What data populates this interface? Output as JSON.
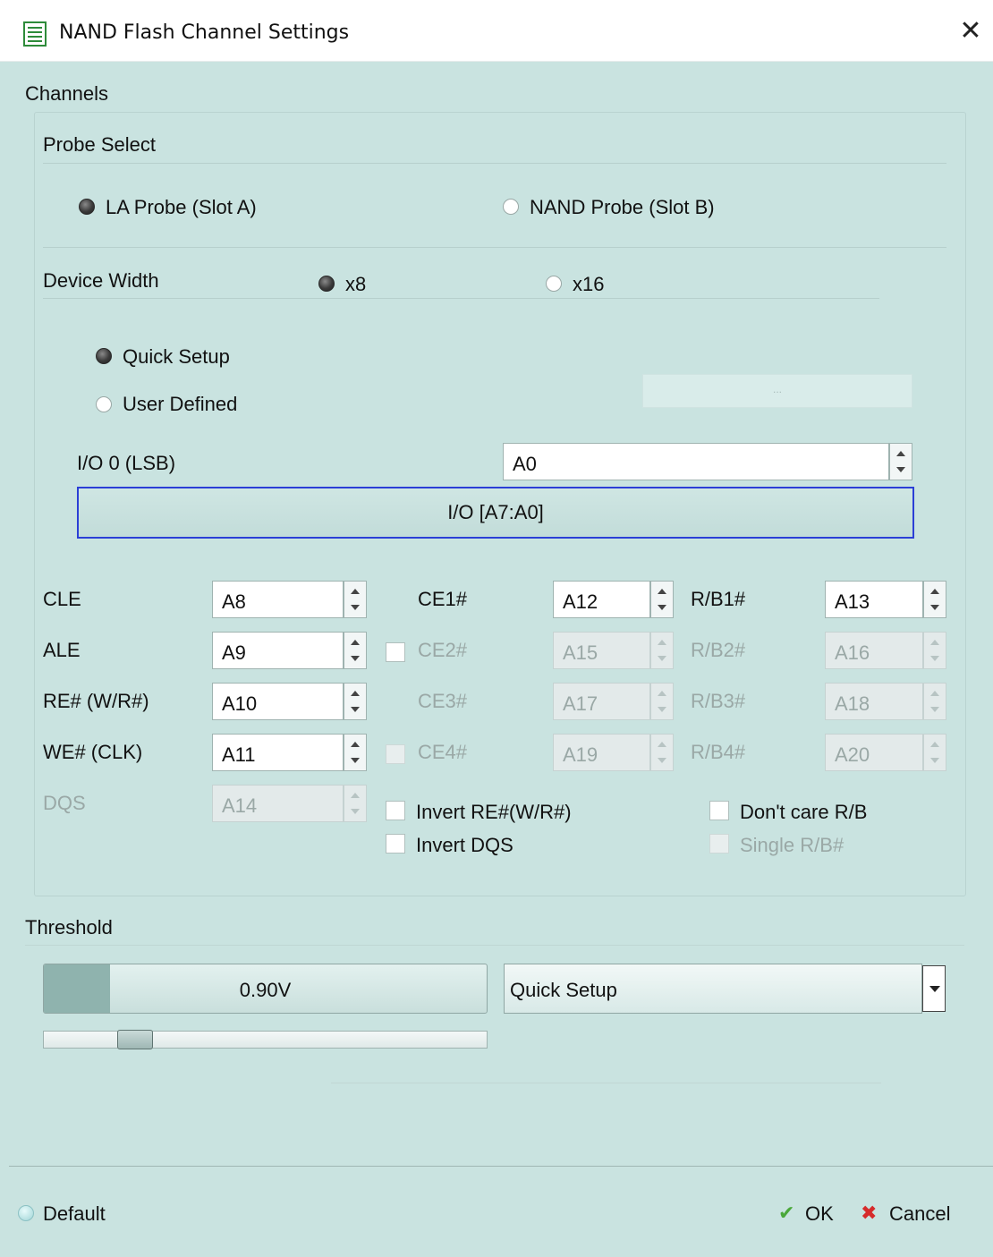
{
  "window": {
    "title": "NAND Flash Channel Settings",
    "close_glyph": "✕"
  },
  "channels": {
    "group_label": "Channels",
    "probe_select": {
      "label": "Probe Select",
      "options": [
        {
          "label": "LA Probe (Slot A)",
          "selected": true
        },
        {
          "label": "NAND Probe (Slot B)",
          "selected": false
        }
      ]
    },
    "device_width": {
      "label": "Device Width",
      "options": [
        {
          "label": "x8",
          "selected": true
        },
        {
          "label": "x16",
          "selected": false
        }
      ]
    },
    "setup_mode": {
      "options": [
        {
          "label": "Quick Setup",
          "selected": true
        },
        {
          "label": "User Defined",
          "selected": false
        }
      ],
      "user_defined_button": "..."
    },
    "io0": {
      "label": "I/O 0 (LSB)",
      "value": "A0"
    },
    "io_button": "I/O [A7:A0]",
    "signals_left": [
      {
        "label": "CLE",
        "value": "A8",
        "enabled": true
      },
      {
        "label": "ALE",
        "value": "A9",
        "enabled": true
      },
      {
        "label": "RE# (W/R#)",
        "value": "A10",
        "enabled": true
      },
      {
        "label": "WE# (CLK)",
        "value": "A11",
        "enabled": true
      },
      {
        "label": "DQS",
        "value": "A14",
        "enabled": false
      }
    ],
    "signals_ce": [
      {
        "label": "CE1#",
        "value": "A12",
        "enabled": true,
        "checkbox": false
      },
      {
        "label": "CE2#",
        "value": "A15",
        "enabled": false,
        "checkbox": true
      },
      {
        "label": "CE3#",
        "value": "A17",
        "enabled": false,
        "checkbox": false
      },
      {
        "label": "CE4#",
        "value": "A19",
        "enabled": false,
        "checkbox": true
      }
    ],
    "signals_rb": [
      {
        "label": "R/B1#",
        "value": "A13",
        "enabled": true
      },
      {
        "label": "R/B2#",
        "value": "A16",
        "enabled": false
      },
      {
        "label": "R/B3#",
        "value": "A18",
        "enabled": false
      },
      {
        "label": "R/B4#",
        "value": "A20",
        "enabled": false
      }
    ],
    "options": {
      "invert_re": "Invert RE#(W/R#)",
      "invert_dqs": "Invert DQS",
      "dont_care_rb": "Don't care R/B",
      "single_rb": "Single R/B#"
    }
  },
  "threshold": {
    "label": "Threshold",
    "value": "0.90V",
    "level_fraction": 0.15,
    "slider_fraction": 0.18,
    "preset": "Quick Setup"
  },
  "footer": {
    "default_label": "Default",
    "ok_label": "OK",
    "cancel_label": "Cancel",
    "ok_glyph": "✔",
    "cancel_glyph": "✖"
  },
  "colors": {
    "accent_border": "#2b3fd6",
    "ok_green": "#4aa83a",
    "cancel_red": "#d62b2b",
    "background": "#c9e3e0"
  }
}
